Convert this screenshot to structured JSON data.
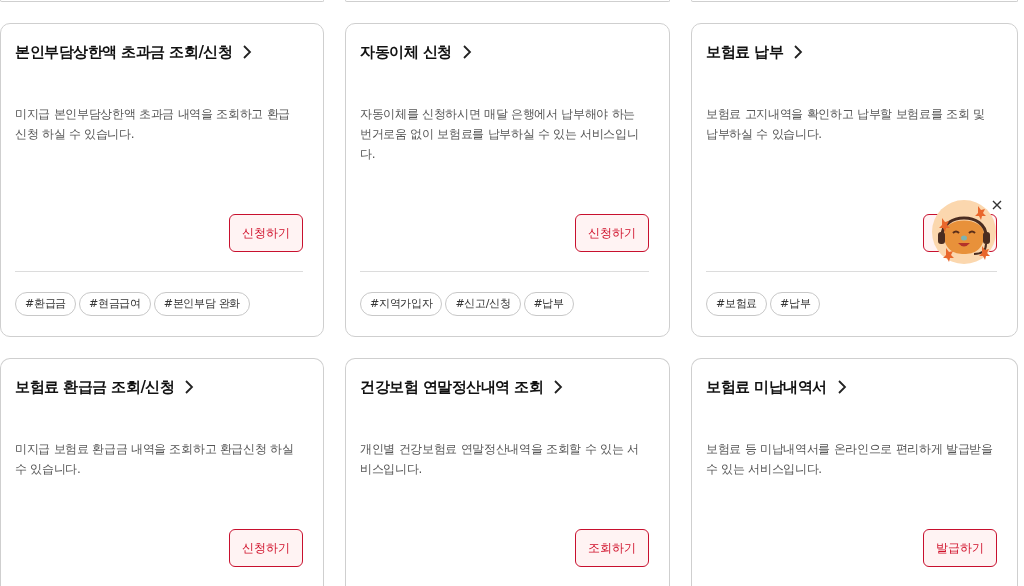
{
  "cards": [
    {
      "title": "본인부담상한액 초과금 조회/신청",
      "description": "미지급 본인부담상한액 초과금 내역을 조회하고 환급 신청 하실 수 있습니다.",
      "has_button": true,
      "button_label": "신청하기",
      "tags": [
        "#환급금",
        "#현금급여",
        "#본인부담 완화"
      ]
    },
    {
      "title": "자동이체 신청",
      "description": "자동이체를 신청하시면 매달 은행에서 납부해야 하는 번거로움 없이 보험료를 납부하실 수 있는 서비스입니다.",
      "has_button": true,
      "button_label": "신청하기",
      "tags": [
        "#지역가입자",
        "#신고/신청",
        "#납부"
      ]
    },
    {
      "title": "보험료 납부",
      "description": "보험료 고지내역을 확인하고 납부할 보험료를 조회 및 납부하실 수 있습니다.",
      "has_button": true,
      "tags": [
        "#보험료",
        "#납부"
      ],
      "chatbot_overlay": true
    },
    {
      "title": "보험료 환급금 조회/신청",
      "description": "미지급 보험료 환급금 내역을 조회하고 환급신청 하실 수 있습니다.",
      "has_button": true,
      "button_label": "신청하기"
    },
    {
      "title": "건강보험 연말정산내역 조회",
      "description": "개인별 건강보험료 연말정산내역을 조회할 수 있는 서비스입니다.",
      "has_button": true,
      "button_label": "조회하기"
    },
    {
      "title": "보험료 미납내역서",
      "description": "보험료 등 미납내역서를 온라인으로 편리하게 발급받을 수 있는 서비스입니다.",
      "has_button": true,
      "button_label": "발급하기"
    }
  ]
}
